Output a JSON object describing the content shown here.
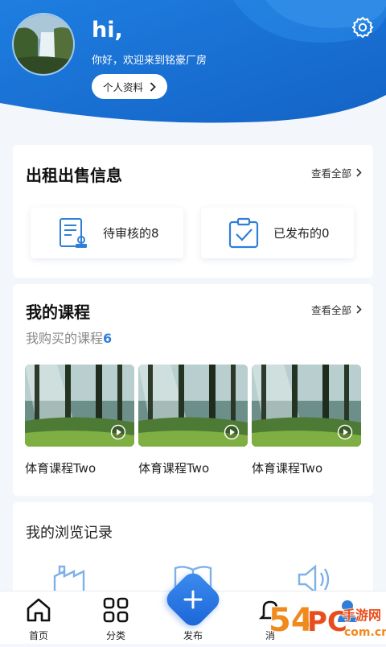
{
  "header": {
    "greeting": "hi,",
    "welcome": "你好，欢迎来到铭豪厂房",
    "profile_button": "个人资料"
  },
  "rental": {
    "title": "出租出售信息",
    "view_all": "查看全部",
    "pending": "待审核的8",
    "published": "已发布的0"
  },
  "courses": {
    "title": "我的课程",
    "view_all": "查看全部",
    "purchased_label": "我购买的课程",
    "purchased_count": "6",
    "items": [
      {
        "name": "体育课程Two"
      },
      {
        "name": "体育课程Two"
      },
      {
        "name": "体育课程Two"
      }
    ]
  },
  "history": {
    "title": "我的浏览记录"
  },
  "tabbar": {
    "home": "首页",
    "category": "分类",
    "publish": "发布",
    "message": "消",
    "mine": ""
  },
  "watermark": {
    "text": "54PC手游网",
    "url": "com.cn"
  },
  "colors": {
    "primary": "#1a73d9",
    "accent_dark": "#1565c8",
    "icon_blue": "#2f7fd8",
    "count_blue": "#2f7fd8"
  }
}
